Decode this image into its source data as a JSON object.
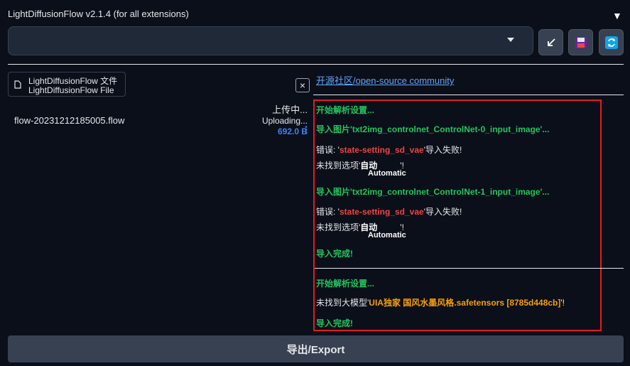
{
  "app": {
    "title": "LightDiffusionFlow v2.1.4 (for all extensions)",
    "collapse_glyph": "▼"
  },
  "dropdown": {
    "value": ""
  },
  "toolbar": {
    "buttons": [
      {
        "icon": "arrow-down-left-icon",
        "bg": "#374151"
      },
      {
        "icon": "save-icon",
        "bg": "#374151"
      },
      {
        "icon": "refresh-icon",
        "bg": "#0ea5e9"
      }
    ]
  },
  "file_upload": {
    "label_cn": "LightDiffusionFlow 文件",
    "label_en": "LightDiffusionFlow File",
    "clear_glyph": "×",
    "file_name": "flow-20231212185005.flow",
    "status_cn": "上传中...",
    "status_en": "Uploading...",
    "size": "692.0 B"
  },
  "community": {
    "link_text": "开源社区/open-source community"
  },
  "log": {
    "lines": [
      {
        "parts": [
          {
            "text": "开始解析设置...",
            "style": "g"
          }
        ]
      },
      {
        "parts": [
          {
            "text": "导入图片'txt2img_controlnet_ControlNet-0_input_image'...",
            "style": "g"
          }
        ]
      },
      {
        "parts": [
          {
            "text": "错误: '"
          },
          {
            "text": "state-setting_sd_vae",
            "style": "r"
          },
          {
            "text": "'导入失败!"
          }
        ]
      },
      {
        "parts": [
          {
            "text": "未找到选项'"
          },
          {
            "text": "自动",
            "style": "w"
          },
          {
            "text": "'!"
          }
        ],
        "sub": "Automatic"
      },
      {
        "parts": [
          {
            "text": "导入图片'txt2img_controlnet_ControlNet-1_input_image'...",
            "style": "g"
          }
        ]
      },
      {
        "parts": [
          {
            "text": "错误: '"
          },
          {
            "text": "state-setting_sd_vae",
            "style": "r"
          },
          {
            "text": "'导入失败!"
          }
        ]
      },
      {
        "parts": [
          {
            "text": "未找到选项'"
          },
          {
            "text": "自动",
            "style": "w"
          },
          {
            "text": "'!"
          }
        ],
        "sub": "Automatic"
      },
      {
        "parts": [
          {
            "text": "导入完成!",
            "style": "g"
          }
        ]
      },
      {
        "parts": [
          {
            "text": "开始解析设置...",
            "style": "g"
          }
        ]
      },
      {
        "parts": [
          {
            "text": "未找到大模型'"
          },
          {
            "text": "UIA独家 国风水墨风格.safetensors [8785d448cb]",
            "style": "o"
          },
          {
            "text": "'!"
          }
        ]
      },
      {
        "parts": [
          {
            "text": "导入完成!",
            "style": "g"
          }
        ]
      }
    ]
  },
  "export": {
    "label": "导出/Export"
  },
  "colors": {
    "background": "#0b0f19",
    "highlight_box": "#e11d1d",
    "success": "#22c55e",
    "error": "#ef4444",
    "warning": "#f59e0b",
    "link": "#60a5fa"
  }
}
